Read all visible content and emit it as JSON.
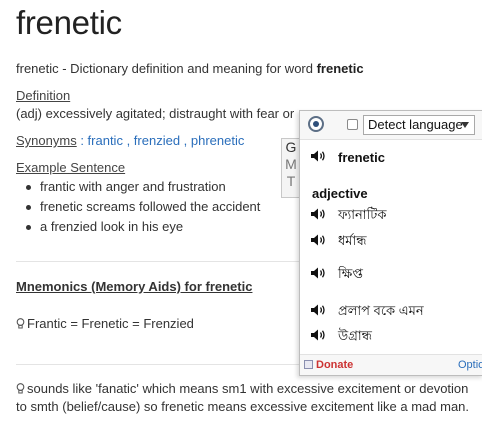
{
  "page": {
    "title": "frenetic",
    "subtitle_prefix": "frenetic - Dictionary definition and meaning for word ",
    "subtitle_word": "frenetic",
    "definition_label": "Definition",
    "definition_text": "(adj) excessively agitated; distraught with fear or",
    "synonyms_label": "Synonyms",
    "synonyms_sep": " : ",
    "synonyms": [
      "frantic",
      "frenzied",
      "phrenetic"
    ],
    "example_label": "Example Sentence",
    "examples": [
      "frantic with anger and frustration",
      "frenetic screams followed the accident",
      "a frenzied look in his eye"
    ],
    "mnemonics_heading": "Mnemonics (Memory Aids) for frenetic",
    "mnemonic_1": "Frantic = Frenetic = Frenzied",
    "mnemonic_2": "sounds like 'fanatic' which means sm1 with excessive excitement or devotion to smth (belief/cause) so frenetic means excessive excitement like a mad man."
  },
  "gmt_tab": [
    "G",
    "M",
    "T"
  ],
  "popup": {
    "language_select": "Detect language",
    "word": "frenetic",
    "part_of_speech": "adjective",
    "translations": [
      "ফ্যানাটিক",
      "ধর্মান্ধ",
      "ক্ষিপ্ত",
      "প্রলাপ বকে এমন",
      "উগ্রান্ধ"
    ],
    "donate": "Donate",
    "options": "Optio"
  },
  "colors": {
    "link": "#2a6ebb",
    "donate": "#cc3333"
  }
}
